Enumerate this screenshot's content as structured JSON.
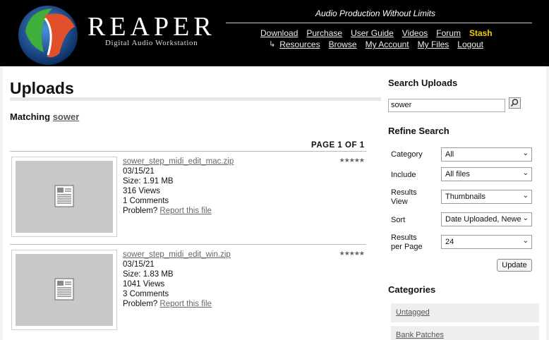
{
  "header": {
    "brand": "REAPER",
    "brand_sub": "Digital Audio Workstation",
    "tagline": "Audio Production Without Limits",
    "nav_primary": [
      "Download",
      "Purchase",
      "User Guide",
      "Videos",
      "Forum",
      "Stash"
    ],
    "nav_secondary": [
      "Resources",
      "Browse",
      "My Account",
      "My Files",
      "Logout"
    ]
  },
  "main": {
    "title": "Uploads",
    "matching_label": "Matching",
    "matching_term": "sower",
    "pager": "PAGE 1 OF 1",
    "items": [
      {
        "filename": "sower_step_midi_edit_mac.zip",
        "date": "03/15/21",
        "size": "Size: 1.91 MB",
        "views": "316 Views",
        "comments": "1 Comments",
        "problem": "Problem?",
        "report": "Report this file",
        "rating": 5
      },
      {
        "filename": "sower_step_midi_edit_win.zip",
        "date": "03/15/21",
        "size": "Size: 1.83 MB",
        "views": "1041 Views",
        "comments": "3 Comments",
        "problem": "Problem?",
        "report": "Report this file",
        "rating": 5
      }
    ]
  },
  "sidebar": {
    "search_title": "Search Uploads",
    "search_value": "sower",
    "refine_title": "Refine Search",
    "category_label": "Category",
    "category_value": "All",
    "include_label": "Include",
    "include_value": "All files",
    "view_label_1": "Results",
    "view_label_2": "View",
    "view_value": "Thumbnails",
    "sort_label": "Sort",
    "sort_value": "Date Uploaded, Newe",
    "perpage_label_1": "Results",
    "perpage_label_2": "per Page",
    "perpage_value": "24",
    "update_label": "Update",
    "categories_title": "Categories",
    "categories": [
      "Untagged",
      "Bank Patches"
    ]
  }
}
